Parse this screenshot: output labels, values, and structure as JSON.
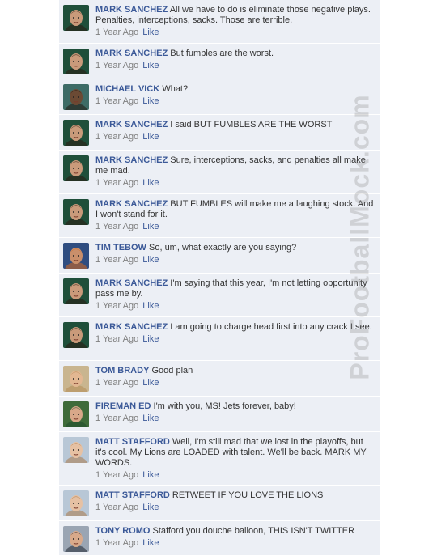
{
  "watermark": "ProFootballMock.com",
  "colors": {
    "feed_background": "#eceff5",
    "name_link": "#3b5998",
    "meta_text": "#808080",
    "body_text": "#333333"
  },
  "comments": [
    {
      "name": "MARK SANCHEZ",
      "text": "All we have to do is eliminate those negative plays. Penalties, interceptions, sacks. Those are terrible.",
      "time": "1 Year Ago",
      "like": "Like",
      "avatar": "mark-sanchez-avatar"
    },
    {
      "name": "MARK SANCHEZ",
      "text": "But fumbles are the worst.",
      "time": "1 Year Ago",
      "like": "Like",
      "avatar": "mark-sanchez-avatar"
    },
    {
      "name": "MICHAEL VICK",
      "text": "What?",
      "time": "1 Year Ago",
      "like": "Like",
      "avatar": "michael-vick-avatar"
    },
    {
      "name": "MARK SANCHEZ",
      "text": "I said BUT FUMBLES ARE THE WORST",
      "time": "1 Year Ago",
      "like": "Like",
      "avatar": "mark-sanchez-avatar"
    },
    {
      "name": "MARK SANCHEZ",
      "text": "Sure, interceptions, sacks, and penalties all make me mad.",
      "time": "1 Year Ago",
      "like": "Like",
      "avatar": "mark-sanchez-avatar"
    },
    {
      "name": "MARK SANCHEZ",
      "text": "BUT FUMBLES will make me a laughing stock. And I won't stand for it.",
      "time": "1 Year Ago",
      "like": "Like",
      "avatar": "mark-sanchez-avatar"
    },
    {
      "name": "TIM TEBOW",
      "text": "So, um, what exactly are you saying?",
      "time": "1 Year Ago",
      "like": "Like",
      "avatar": "tim-tebow-avatar"
    },
    {
      "name": "MARK SANCHEZ",
      "text": "I'm saying that this year, I'm not letting opportunity pass me by.",
      "time": "1 Year Ago",
      "like": "Like",
      "avatar": "mark-sanchez-avatar"
    },
    {
      "name": "MARK SANCHEZ",
      "text": "I am going to charge head first into any crack I see.",
      "time": "1 Year Ago",
      "like": "Like",
      "avatar": "mark-sanchez-avatar"
    },
    {
      "name": "TOM BRADY",
      "text": "Good plan",
      "time": "1 Year Ago",
      "like": "Like",
      "avatar": "tom-brady-avatar"
    },
    {
      "name": "FIREMAN ED",
      "text": "I'm with you, MS! Jets forever, baby!",
      "time": "1 Year Ago",
      "like": "Like",
      "avatar": "fireman-ed-avatar"
    },
    {
      "name": "MATT STAFFORD",
      "text": "Well, I'm still mad that we lost in the playoffs, but it's cool. My Lions are LOADED with talent. We'll be back. MARK MY WORDS.",
      "time": "1 Year Ago",
      "like": "Like",
      "avatar": "matt-stafford-avatar"
    },
    {
      "name": "MATT STAFFORD",
      "text": "RETWEET IF YOU LOVE THE LIONS",
      "time": "1 Year Ago",
      "like": "Like",
      "avatar": "matt-stafford-avatar"
    },
    {
      "name": "TONY ROMO",
      "text": "Stafford you douche balloon, THIS ISN'T TWITTER",
      "time": "1 Year Ago",
      "like": "Like",
      "avatar": "tony-romo-avatar"
    }
  ]
}
